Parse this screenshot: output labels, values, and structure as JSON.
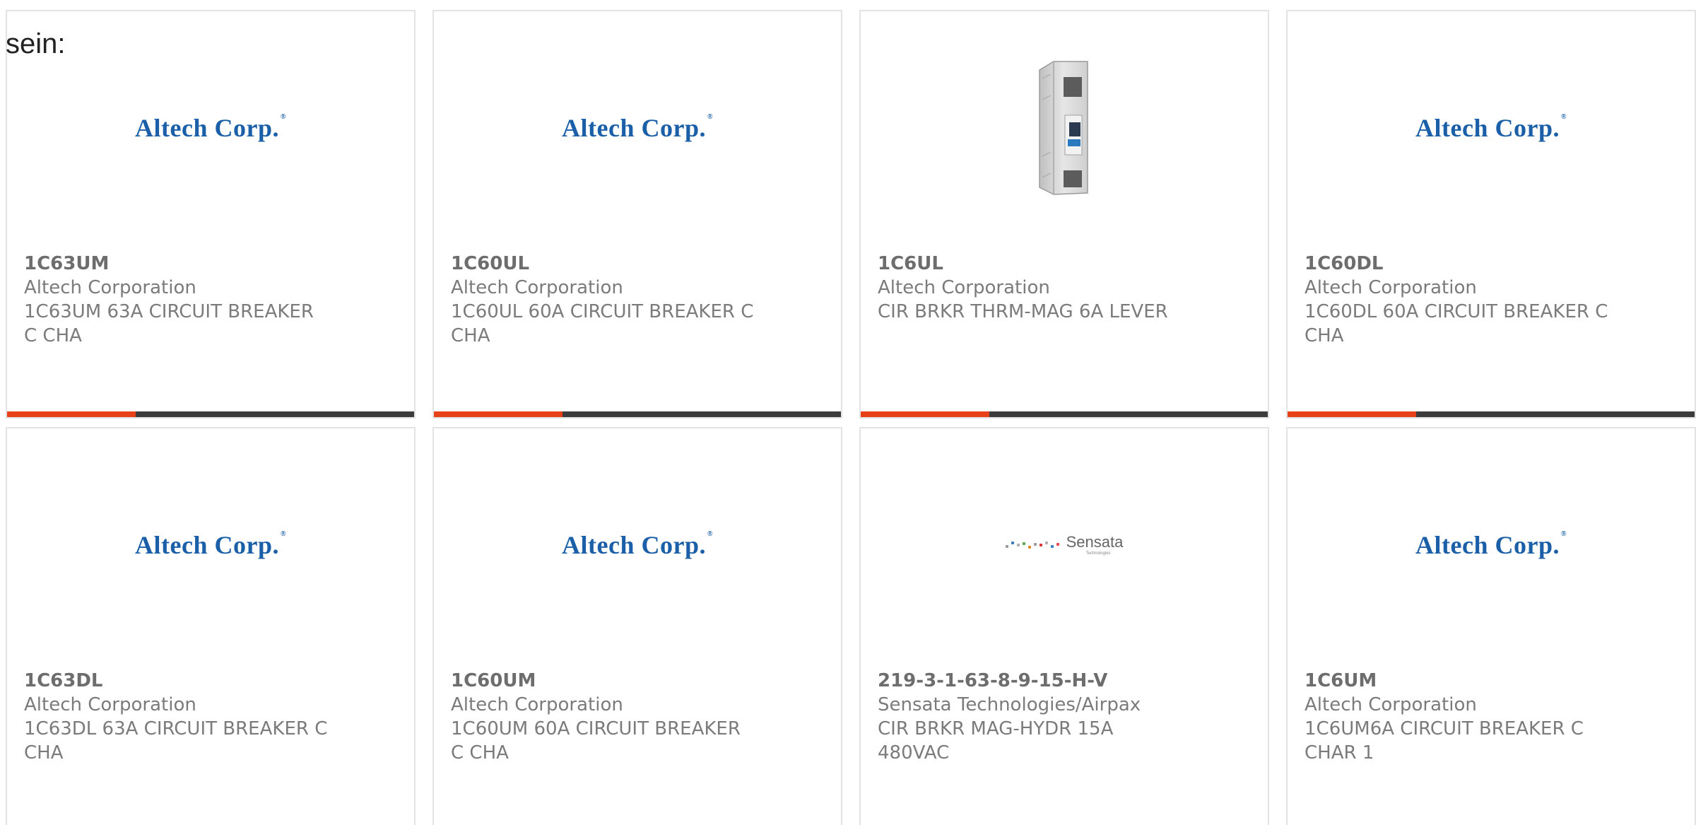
{
  "intro_text": "sein:",
  "colors": {
    "accent_bar": "#e8411a",
    "dark_bar": "#3c3c3c",
    "altech_blue": "#1a5fa8",
    "card_border": "#e3e3e3"
  },
  "products": [
    {
      "part_number": "1C63UM",
      "manufacturer": "Altech Corporation",
      "description": "1C63UM 63A CIRCUIT BREAKER C CHA",
      "image": "altech-logo",
      "logo_text": "Altech Corp."
    },
    {
      "part_number": "1C60UL",
      "manufacturer": "Altech Corporation",
      "description": "1C60UL 60A CIRCUIT BREAKER C CHA",
      "image": "altech-logo",
      "logo_text": "Altech Corp."
    },
    {
      "part_number": "1C6UL",
      "manufacturer": "Altech Corporation",
      "description": "CIR BRKR THRM-MAG 6A LEVER",
      "image": "circuit-breaker-photo"
    },
    {
      "part_number": "1C60DL",
      "manufacturer": "Altech Corporation",
      "description": "1C60DL 60A CIRCUIT BREAKER C CHA",
      "image": "altech-logo",
      "logo_text": "Altech Corp."
    },
    {
      "part_number": "1C63DL",
      "manufacturer": "Altech Corporation",
      "description": "1C63DL 63A CIRCUIT BREAKER C CHA",
      "image": "altech-logo",
      "logo_text": "Altech Corp."
    },
    {
      "part_number": "1C60UM",
      "manufacturer": "Altech Corporation",
      "description": "1C60UM 60A CIRCUIT BREAKER C CHA",
      "image": "altech-logo",
      "logo_text": "Altech Corp."
    },
    {
      "part_number": "219-3-1-63-8-9-15-H-V",
      "manufacturer": "Sensata Technologies/Airpax",
      "description": "CIR BRKR MAG-HYDR 15A 480VAC",
      "image": "sensata-logo",
      "logo_text": "Sensata",
      "logo_tagline": "Technologies"
    },
    {
      "part_number": "1C6UM",
      "manufacturer": "Altech Corporation",
      "description": "1C6UM6A CIRCUIT BREAKER C CHAR 1",
      "image": "altech-logo",
      "logo_text": "Altech Corp."
    }
  ]
}
